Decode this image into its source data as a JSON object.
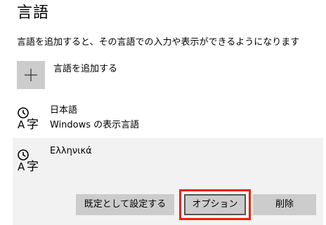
{
  "page": {
    "title": "言語",
    "description": "言語を追加すると、その言語での入力や表示ができるようになります"
  },
  "add_language": {
    "label": "言語を追加する",
    "icon": "plus-icon"
  },
  "languages": [
    {
      "name": "日本語",
      "subtitle": "Windows の表示言語",
      "icon": "language-icon"
    },
    {
      "name": "Ελληνικά",
      "icon": "language-icon",
      "selected": true
    }
  ],
  "actions": {
    "set_default_label": "既定として設定する",
    "options_label": "オプション",
    "remove_label": "削除"
  },
  "colors": {
    "highlight": "#ee2200",
    "button_bg": "#cccccc",
    "selected_bg": "#f2f2f2"
  }
}
